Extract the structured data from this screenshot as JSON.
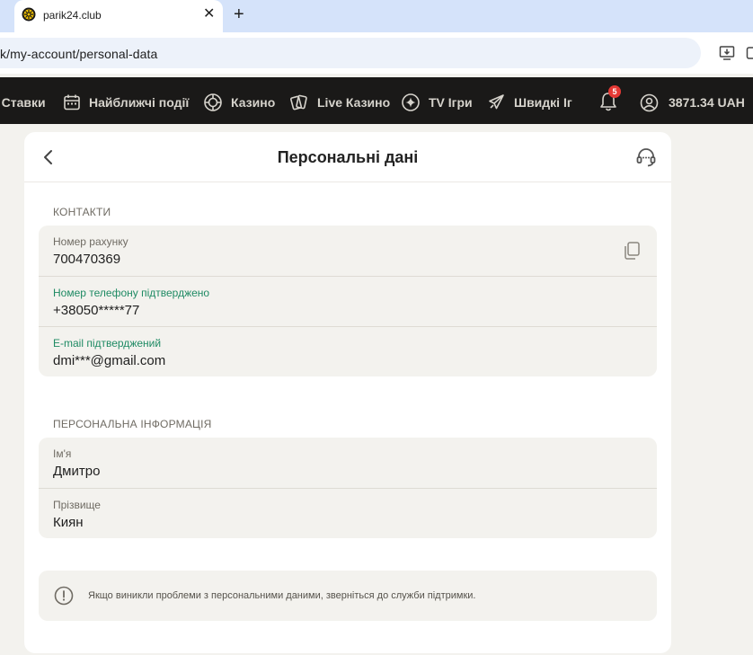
{
  "browser": {
    "tab_title": "parik24.club",
    "tab_close": "✕",
    "new_tab": "+",
    "url": "k/my-account/personal-data"
  },
  "nav": {
    "items": [
      {
        "label": "е Ставки",
        "icon": "none"
      },
      {
        "label": "Найближчі події",
        "icon": "calendar-icon"
      },
      {
        "label": "Казино",
        "icon": "casino-chip-icon"
      },
      {
        "label": "Live Казино",
        "icon": "cards-icon"
      },
      {
        "label": "TV Ігри",
        "icon": "sparkle-icon"
      },
      {
        "label": "Швидкі Іг",
        "icon": "rocket-icon"
      }
    ],
    "notifications_count": "5",
    "balance": "3871.34 UAH"
  },
  "page": {
    "title": "Персональні дані",
    "contacts_label": "КОНТАКТИ",
    "contacts": [
      {
        "label": "Номер рахунку",
        "value": "700470369",
        "verified": false
      },
      {
        "label": "Номер телефону підтверджено",
        "value": "+38050*****77",
        "verified": true
      },
      {
        "label": "E-mail підтверджений",
        "value": "dmi***@gmail.com",
        "verified": true
      }
    ],
    "personal_label": "ПЕРСОНАЛЬНА ІНФОРМАЦІЯ",
    "personal": [
      {
        "label": "Ім'я",
        "value": "Дмитро"
      },
      {
        "label": "Прізвище",
        "value": "Киян"
      }
    ],
    "info_text": "Якщо виникли проблеми з персональними даними, зверніться до служби підтримки."
  },
  "colors": {
    "nav_bg": "#1a1918",
    "page_bg": "#f3f2ee",
    "verified_green": "#1e8a63",
    "badge_red": "#e53935"
  }
}
